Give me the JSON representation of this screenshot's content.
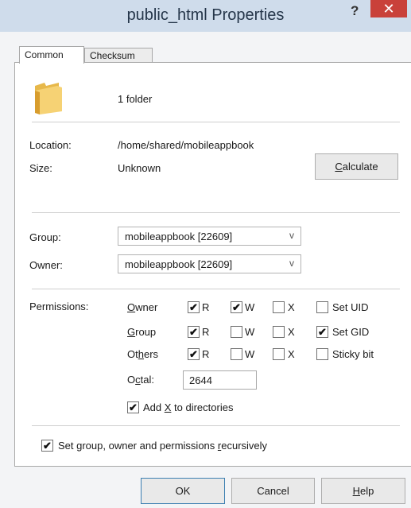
{
  "window": {
    "title": "public_html Properties",
    "help_glyph": "?",
    "close_glyph": "✕"
  },
  "tabs": [
    {
      "label": "Common"
    },
    {
      "label": "Checksum"
    }
  ],
  "summary": "1 folder",
  "location": {
    "label": "Location:",
    "value": "/home/shared/mobileappbook"
  },
  "size": {
    "label": "Size:",
    "value": "Unknown"
  },
  "calculate": {
    "pre": "",
    "key": "C",
    "post": "alculate"
  },
  "group_field": {
    "label": "Group:",
    "value": "mobileappbook [22609]"
  },
  "owner_field": {
    "label": "Owner:",
    "value": "mobileappbook [22609]"
  },
  "dropdown_glyph": "v",
  "permissions": {
    "label": "Permissions:",
    "rows": [
      {
        "pre": "",
        "key": "O",
        "post": "wner",
        "r": true,
        "w": true,
        "x": false,
        "special": "Set UID",
        "special_checked": false
      },
      {
        "pre": "",
        "key": "G",
        "post": "roup",
        "r": true,
        "w": false,
        "x": false,
        "special": "Set GID",
        "special_checked": true
      },
      {
        "pre": "Ot",
        "key": "h",
        "post": "ers",
        "r": true,
        "w": false,
        "x": false,
        "special": "Sticky bit",
        "special_checked": false
      }
    ],
    "r_label": "R",
    "w_label": "W",
    "x_label": "X",
    "octal_pre": "O",
    "octal_key": "c",
    "octal_post": "tal:",
    "octal_value": "2644",
    "add_x": {
      "pre": "Add ",
      "key": "X",
      "post": " to directories",
      "checked": true
    }
  },
  "recursive": {
    "pre": "Set group, owner and permissions ",
    "key": "r",
    "post": "ecursively",
    "checked": true
  },
  "buttons": {
    "ok": "OK",
    "cancel": "Cancel",
    "help_pre": "",
    "help_key": "H",
    "help_post": "elp"
  },
  "check_glyph": "✔"
}
